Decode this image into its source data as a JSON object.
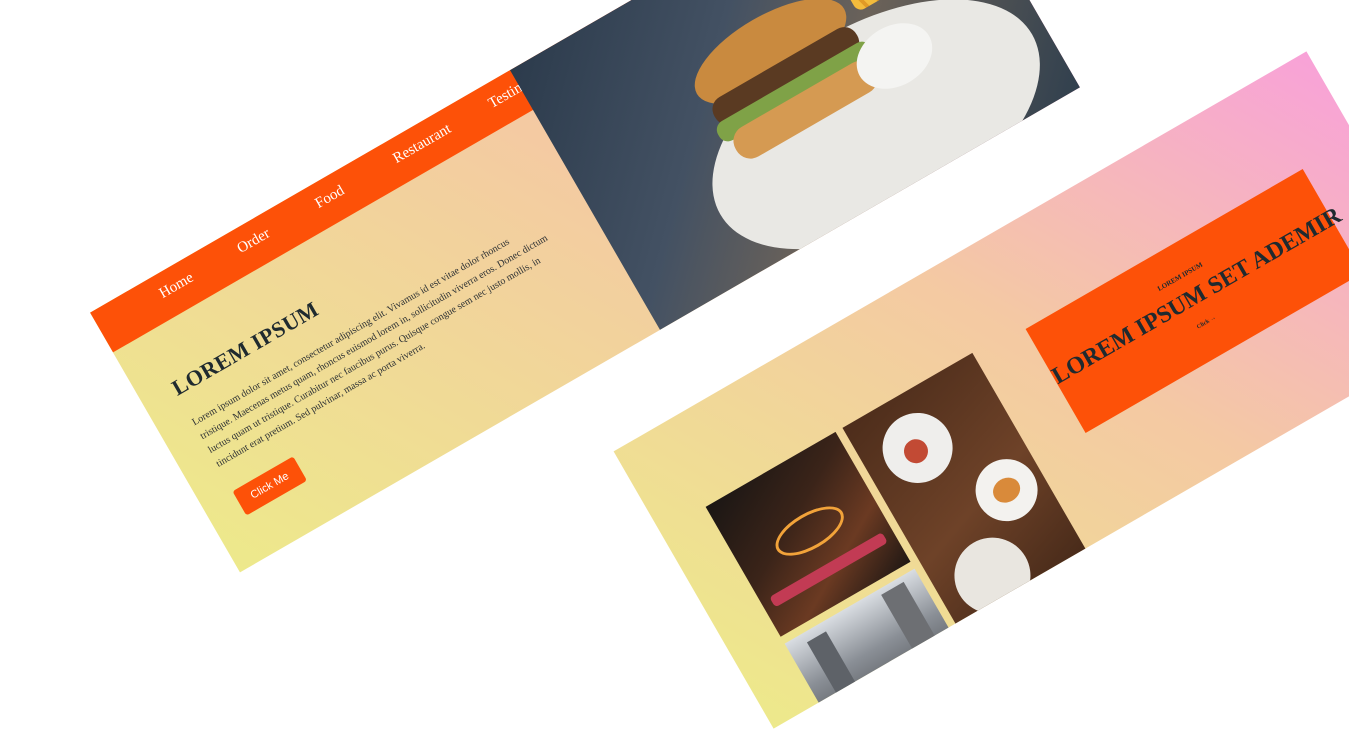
{
  "nav": {
    "items": [
      "Home",
      "Order",
      "Food",
      "Restaurant",
      "Testimonial"
    ]
  },
  "hero": {
    "title": "LOREM IPSUM",
    "text": "Lorem ipsum dolor sit amet, consectetur adipiscing elit. Vivamus id est vitae dolor rhoncus tristique. Maecenas metus quam, rhoncus euismod lorem in, sollicitudin viverra eros. Donec dictum luctus quam ut tristique. Curabitur nec faucibus purus. Quisque congue sem nec justo mollis, in tincidunt erat pretium. Sed pulvinar, massa ac porta viverra.",
    "button_label": "Click Me"
  },
  "promo": {
    "small_label": "LOREM IPSUM",
    "title": "LOREM IPSUM SET ADEMIR",
    "link_label": "Click →"
  },
  "images": {
    "hero": "burger-and-fries-photo",
    "gallery": [
      "neon-street-bar-photo",
      "shopping-street-photo",
      "restaurant-table-dishes-photo"
    ]
  },
  "colors": {
    "accent": "#fd5108",
    "gradient_start": "#ede98b",
    "gradient_end": "#f8a2d8",
    "text_dark": "#1f2a2f"
  }
}
